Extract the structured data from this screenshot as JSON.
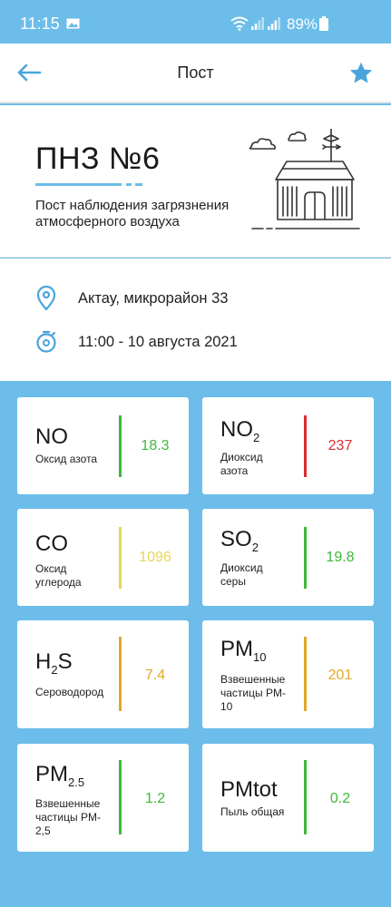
{
  "status_bar": {
    "time": "11:15",
    "battery": "89%"
  },
  "app_bar": {
    "title": "Пост",
    "back_icon": "arrow-left-icon",
    "favorite_icon": "star-icon"
  },
  "post": {
    "name": "ПНЗ №6",
    "description": "Пост наблюдения загрязнения атмосферного воздуха"
  },
  "info": {
    "location": "Актау, микрорайон 33",
    "datetime": "11:00 - 10 августа 2021"
  },
  "colors": {
    "accent": "#6cbde9",
    "green": "#3eb83b",
    "red": "#d92d2d",
    "yellow_light": "#e5d65a",
    "orange": "#e0a82a"
  },
  "pollutants": [
    {
      "formula": "NO",
      "sub": "",
      "name": "Оксид азота",
      "value": "18.3",
      "color": "#3eb83b"
    },
    {
      "formula": "NO",
      "sub": "2",
      "name": "Диоксид азота",
      "value": "237",
      "color": "#d92d2d"
    },
    {
      "formula": "CO",
      "sub": "",
      "name": "Оксид углерода",
      "value": "1096",
      "color": "#e5d65a"
    },
    {
      "formula": "SO",
      "sub": "2",
      "name": "Диоксид серы",
      "value": "19.8",
      "color": "#3eb83b"
    },
    {
      "formula": "H",
      "sub": "2",
      "formula_tail": "S",
      "name": "Сероводород",
      "value": "7.4",
      "color": "#e0a82a"
    },
    {
      "formula": "PM",
      "sub": "10",
      "name": "Взвешенные частицы PM-10",
      "value": "201",
      "color": "#e0a82a"
    },
    {
      "formula": "PM",
      "sub": "2.5",
      "name": "Взвешенные частицы PM-2,5",
      "value": "1.2",
      "color": "#3eb83b"
    },
    {
      "formula": "PMtot",
      "sub": "",
      "name": "Пыль общая",
      "value": "0.2",
      "color": "#3eb83b"
    }
  ]
}
